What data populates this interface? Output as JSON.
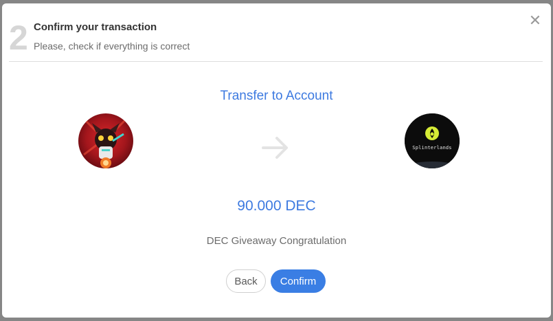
{
  "header": {
    "step": "2",
    "title": "Confirm your transaction",
    "subtitle": "Please, check if everything is correct"
  },
  "transfer": {
    "title": "Transfer to Account",
    "amount": "90.000 DEC",
    "memo": "DEC Giveaway Congratulation",
    "recipient_logo_text": "Splinterlands"
  },
  "buttons": {
    "back_label": "Back",
    "confirm_label": "Confirm"
  },
  "icons": {
    "close": "close-icon",
    "arrow": "arrow-right-icon"
  },
  "colors": {
    "accent": "#3d7ae0",
    "confirm_button": "#3a7ee4",
    "step_number": "#d6d6d6"
  }
}
